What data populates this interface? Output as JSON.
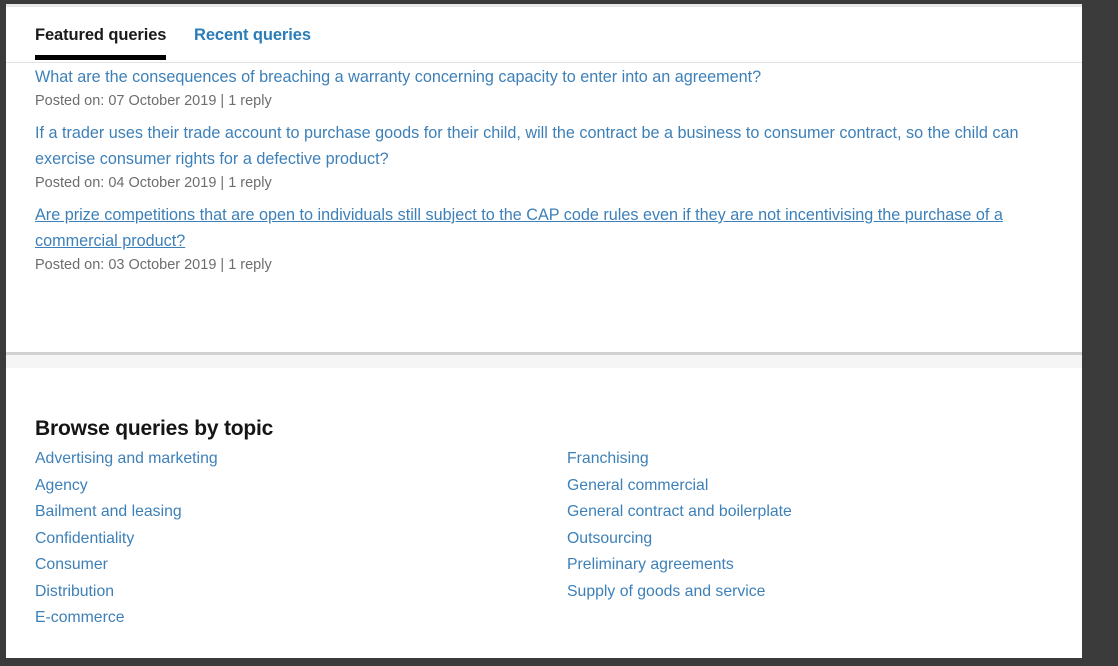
{
  "tabs": [
    {
      "label": "Featured queries",
      "active": true
    },
    {
      "label": "Recent queries",
      "active": false
    }
  ],
  "queries": [
    {
      "title": "What are the consequences of breaching a warranty concerning capacity to enter into an agreement?",
      "meta": "Posted on: 07 October 2019 | 1 reply",
      "hovered": false
    },
    {
      "title": "If a trader uses their trade account to purchase goods for their child, will the contract be a business to consumer contract, so the child can exercise consumer rights for a defective product?",
      "meta": "Posted on: 04 October 2019 | 1 reply",
      "hovered": false
    },
    {
      "title": "Are prize competitions that are open to individuals still subject to the CAP code rules even if they are not incentivising the purchase of a commercial product?",
      "meta": "Posted on: 03 October 2019 | 1 reply",
      "hovered": true
    }
  ],
  "topics": {
    "heading": "Browse queries by topic",
    "left_column": [
      "Advertising and marketing",
      "Agency",
      "Bailment and leasing",
      "Confidentiality",
      "Consumer",
      "Distribution",
      "E-commerce"
    ],
    "right_column": [
      "Franchising",
      "General commercial",
      "General contract and boilerplate",
      "Outsourcing",
      "Preliminary agreements",
      "Supply of goods and service"
    ]
  },
  "colors": {
    "link": "#3d80b8",
    "tab_active": "#1a1a1a",
    "tab_inactive": "#2b7cb8",
    "meta_text": "#6d6d6d",
    "frame": "#3b3b3b",
    "divider_band": "#f5f5f5"
  }
}
